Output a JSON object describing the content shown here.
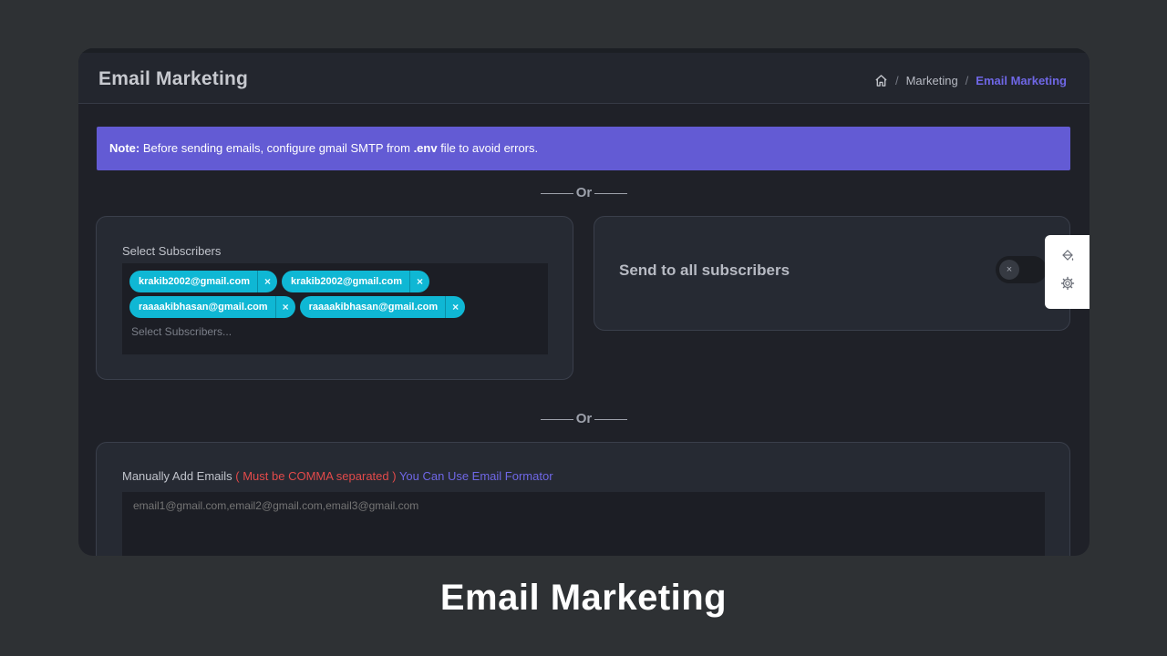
{
  "header": {
    "title": "Email Marketing",
    "breadcrumb": {
      "home_icon": "home-icon",
      "sep": "/",
      "level1": "Marketing",
      "current": "Email Marketing"
    }
  },
  "note": {
    "prefix": "Note:",
    "text1": " Before sending emails, configure gmail SMTP from ",
    "file": ".env",
    "text2": " file to avoid errors."
  },
  "divider_text": "Or",
  "subscribers": {
    "label": "Select Subscribers",
    "tags": [
      {
        "email": "krakib2002@gmail.com",
        "remove": "×"
      },
      {
        "email": "krakib2002@gmail.com",
        "remove": "×"
      },
      {
        "email": "raaaakibhasan@gmail.com",
        "remove": "×"
      },
      {
        "email": "raaaakibhasan@gmail.com",
        "remove": "×"
      }
    ],
    "placeholder": "Select Subscribers..."
  },
  "send_all": {
    "label": "Send to all subscribers",
    "toggle_state": "off",
    "toggle_glyph": "×"
  },
  "manual": {
    "label": "Manually Add Emails ",
    "warning": "( Must be COMMA separated )",
    "link": " You Can Use Email Formator",
    "placeholder": "email1@gmail.com,email2@gmail.com,email3@gmail.com"
  },
  "side_panel": {
    "icons": [
      "paint-bucket-icon",
      "gear-icon"
    ]
  },
  "colors": {
    "accent": "#635bd4",
    "tag": "#0fb7d4",
    "warning": "#e24a4a",
    "link": "#6f67e6"
  },
  "footer_title": "Email Marketing"
}
